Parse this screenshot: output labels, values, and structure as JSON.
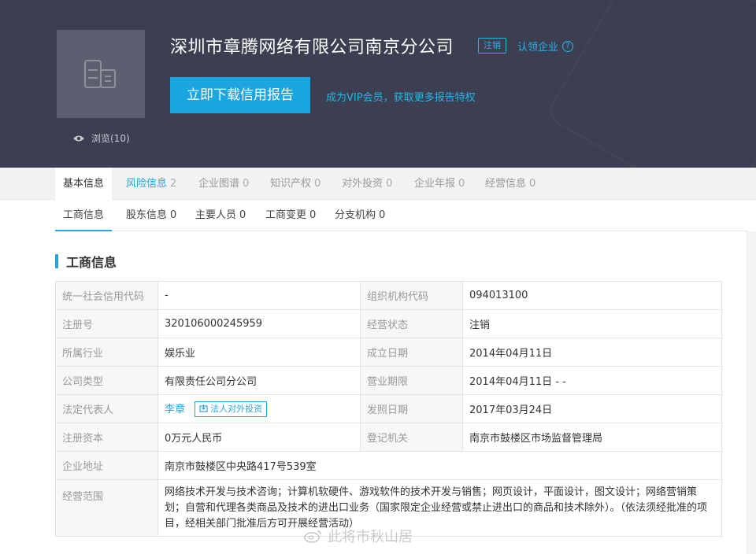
{
  "header": {
    "company_name": "深圳市章腾网络有限公司南京分公司",
    "status_tag": "注销",
    "claim_label": "认领企业",
    "claim_help": "?",
    "views_label": "浏览(10)",
    "download_button": "立即下载信用报告",
    "vip_link": "成为VIP会员，获取更多报告特权"
  },
  "main_tabs": [
    {
      "label": "基本信息",
      "count": ""
    },
    {
      "label": "风险信息",
      "count": "2"
    },
    {
      "label": "企业图谱",
      "count": "0"
    },
    {
      "label": "知识产权",
      "count": "0"
    },
    {
      "label": "对外投资",
      "count": "0"
    },
    {
      "label": "企业年报",
      "count": "0"
    },
    {
      "label": "经营信息",
      "count": "0"
    }
  ],
  "sub_tabs": [
    {
      "label": "工商信息",
      "count": ""
    },
    {
      "label": "股东信息",
      "count": "0"
    },
    {
      "label": "主要人员",
      "count": "0"
    },
    {
      "label": "工商变更",
      "count": "0"
    },
    {
      "label": "分支机构",
      "count": "0"
    }
  ],
  "section_title": "工商信息",
  "info": {
    "credit_code_label": "统一社会信用代码",
    "credit_code": "-",
    "org_code_label": "组织机构代码",
    "org_code": "094013100",
    "reg_no_label": "注册号",
    "reg_no": "320106000245959",
    "biz_status_label": "经营状态",
    "biz_status": "注销",
    "industry_label": "所属行业",
    "industry": "娱乐业",
    "founded_label": "成立日期",
    "founded": "2014年04月11日",
    "company_type_label": "公司类型",
    "company_type": "有限责任公司分公司",
    "term_label": "营业期限",
    "term": "2014年04月11日 - -",
    "legal_rep_label": "法定代表人",
    "legal_rep": "李章",
    "legal_rep_tag": "法人对外投资",
    "issue_date_label": "发照日期",
    "issue_date": "2017年03月24日",
    "capital_label": "注册资本",
    "capital": "0万元人民币",
    "authority_label": "登记机关",
    "authority": "南京市鼓楼区市场监督管理局",
    "address_label": "企业地址",
    "address": "南京市鼓楼区中央路417号539室",
    "scope_label": "经营范围",
    "scope": "网络技术开发与技术咨询；计算机软硬件、游戏软件的技术开发与销售；网页设计，平面设计，图文设计；网络营销策划；自营和代理各类商品及技术的进出口业务（国家限定企业经营或禁止进出口的商品和技术除外）。（依法须经批准的项目，经相关部门批准后方可开展经营活动）"
  },
  "watermark": "此将市秋山居"
}
